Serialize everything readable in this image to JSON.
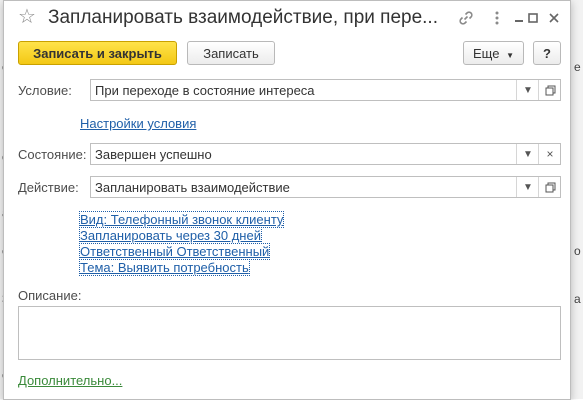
{
  "background": {
    "left_fragments": [
      "е",
      "о",
      "а",
      "е",
      "3",
      "е"
    ],
    "right_fragments": [
      "е",
      "о",
      "а"
    ]
  },
  "window": {
    "title": "Запланировать взаимодействие, при пере...",
    "icons": [
      "star-icon",
      "link-icon",
      "more-vert-icon",
      "minimize-icon",
      "maximize-icon",
      "close-icon"
    ]
  },
  "toolbar": {
    "save_close_label": "Записать и закрыть",
    "save_label": "Записать",
    "more_label": "Еще",
    "help_label": "?"
  },
  "form": {
    "condition": {
      "label": "Условие:",
      "value": "При переходе в состояние интереса"
    },
    "condition_settings_link": "Настройки условия",
    "state": {
      "label": "Состояние:",
      "value": "Завершен успешно"
    },
    "action": {
      "label": "Действие:",
      "value": "Запланировать взаимодействие"
    },
    "action_links": [
      "Вид: Телефонный звонок клиенту",
      "Запланировать через 30 дней",
      "Ответственный Ответственный",
      "Тема: Выявить потребность"
    ],
    "description": {
      "label": "Описание:",
      "value": ""
    },
    "additional_link": "Дополнительно..."
  },
  "colors": {
    "primary_button": "#f3c815",
    "link": "#1f5fa8",
    "additional_link": "#3a8a3a"
  }
}
